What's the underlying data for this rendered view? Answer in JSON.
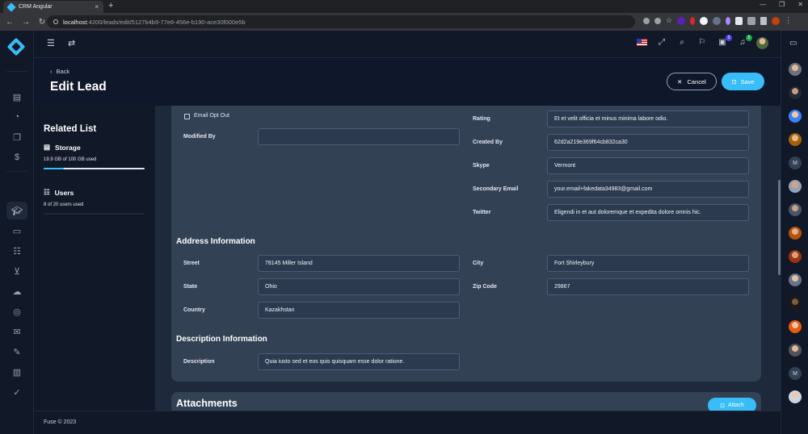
{
  "browser": {
    "tab_title": "CRM Angular",
    "tab_close": "×",
    "new_tab": "+",
    "url_host": "localhost",
    "url_path": ":4200/leads/edit/5127b4b9-77e6-456e-b190-ace30f000e5b"
  },
  "header": {
    "notifications_badge": "3",
    "messages_badge": "5"
  },
  "page": {
    "back_label": "Back",
    "title": "Edit Lead",
    "cancel_label": "Cancel",
    "save_label": "Save"
  },
  "related_list": {
    "title": "Related List",
    "storage": {
      "label": "Storage",
      "usage_text": "19.9 GB of 100 GB used",
      "fraction": 0.199
    },
    "users": {
      "label": "Users",
      "usage_text": "8 of 20 users used",
      "fraction": 0.4
    }
  },
  "form": {
    "email_opt_out_label": "Email Opt Out",
    "modified_by_label": "Modified By",
    "modified_by_value": "",
    "rating_label": "Rating",
    "rating_value": "Et et velit officia et minus minima labore odio.",
    "created_by_label": "Created By",
    "created_by_value": "62d2a219e369f64cb832ca30",
    "skype_label": "Skype",
    "skype_value": "Vermont",
    "secondary_email_label": "Secondary Email",
    "secondary_email_value": "your.email+fakedata34983@gmail.com",
    "twitter_label": "Twitter",
    "twitter_value": "Eligendi in et aut doloremque et expedita dolore omnis hic.",
    "address_section": "Address Information",
    "street_label": "Street",
    "street_value": "78145 Miller Island",
    "city_label": "City",
    "city_value": "Fort Shirleybury",
    "state_label": "State",
    "state_value": "Ohio",
    "zip_label": "Zip Code",
    "zip_value": "29867",
    "country_label": "Country",
    "country_value": "Kazakhstan",
    "description_section": "Description Information",
    "description_label": "Description",
    "description_value": "Quia iusto sed et eos quis quisquam esse dolor ratione."
  },
  "attachments": {
    "title": "Attachments",
    "attach_label": "Attach"
  },
  "footer": {
    "text": "Fuse © 2023"
  },
  "contacts": {
    "initial_1": "M",
    "initial_2": "M"
  },
  "colors": {
    "accent": "#38bdf8",
    "card": "#334155",
    "background": "#0f172a"
  }
}
